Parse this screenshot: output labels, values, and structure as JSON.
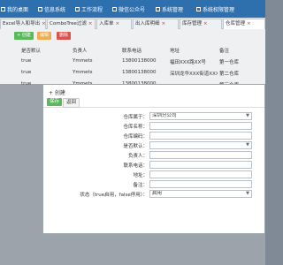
{
  "topnav": {
    "items": [
      {
        "label": "我的桌面",
        "icon": "monitor-icon"
      },
      {
        "label": "信息系统",
        "icon": "info-icon"
      },
      {
        "label": "工作流程",
        "icon": "workflow-icon"
      },
      {
        "label": "微信公众号",
        "icon": "wechat-icon"
      },
      {
        "label": "系统管理",
        "icon": "gear-icon"
      },
      {
        "label": "系统权限管理",
        "icon": "shield-icon"
      }
    ]
  },
  "tabs": [
    {
      "label": "Excel导入和导出"
    },
    {
      "label": "ComboTree过滤"
    },
    {
      "label": "入库单"
    },
    {
      "label": "出入库明细"
    },
    {
      "label": "库存管理"
    },
    {
      "label": "仓库管理"
    }
  ],
  "toolbar": {
    "add_label": "+ 创建",
    "edit_label": "编辑",
    "delete_label": "删除"
  },
  "grid": {
    "columns": [
      "是否默认",
      "负责人",
      "联系电话",
      "地址",
      "备注"
    ],
    "rows": [
      [
        "true",
        "Ymmets",
        "13800138000",
        "福田XXX路XX号",
        "第一仓库"
      ],
      [
        "true",
        "Ymmets",
        "13800138000",
        "深圳龙华XXX街道XXX号",
        "第二仓库"
      ],
      [
        "true",
        "Ymmets",
        "13800138000",
        "",
        "第三仓库"
      ]
    ]
  },
  "dialog": {
    "title": "+ 创建",
    "save_label": "保存",
    "back_label": "返回",
    "fields": [
      {
        "label": "仓库属于：",
        "value": "深圳分公司",
        "type": "select"
      },
      {
        "label": "仓库名称：",
        "value": "",
        "type": "text"
      },
      {
        "label": "仓库编码：",
        "value": "",
        "type": "text"
      },
      {
        "label": "是否默认：",
        "value": "",
        "type": "select"
      },
      {
        "label": "负责人：",
        "value": "",
        "type": "text"
      },
      {
        "label": "联系电话：",
        "value": "",
        "type": "text"
      },
      {
        "label": "地址：",
        "value": "",
        "type": "text"
      },
      {
        "label": "备注：",
        "value": "",
        "type": "text"
      },
      {
        "label": "状态（true启用，false停用）：",
        "value": "启用",
        "type": "select"
      }
    ]
  }
}
